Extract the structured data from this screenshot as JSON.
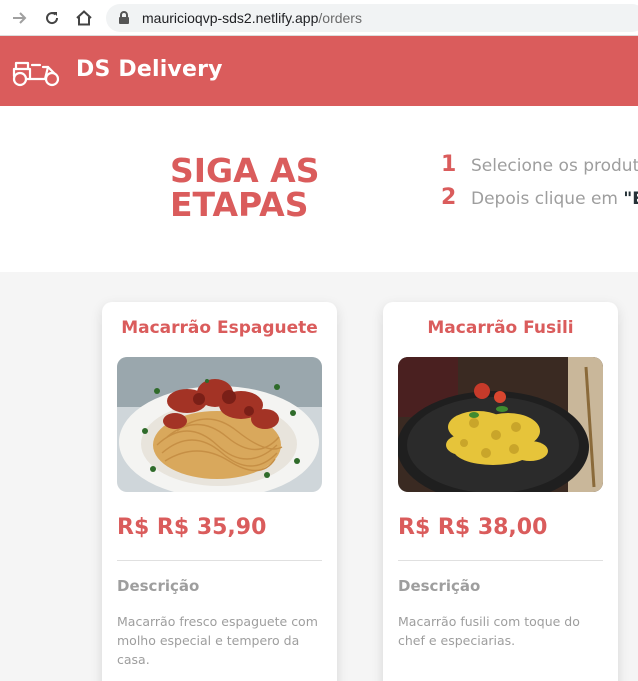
{
  "browser": {
    "url_host": "mauricioqvp-sds2.netlify.app",
    "url_path": "/orders"
  },
  "header": {
    "brand": "DS Delivery",
    "logo_icon": "scooter-icon"
  },
  "steps": {
    "title": "SIGA AS ETAPAS",
    "items": [
      {
        "number": "1",
        "text": "Selecione os produto",
        "strong": ""
      },
      {
        "number": "2",
        "text": "Depois clique em ",
        "strong": "\"EI"
      }
    ]
  },
  "products": [
    {
      "name": "Macarrão Espaguete",
      "price": "R$ R$ 35,90",
      "description_title": "Descrição",
      "description": "Macarrão fresco espaguete com molho especial e tempero da casa."
    },
    {
      "name": "Macarrão Fusili",
      "price": "R$ R$ 38,00",
      "description_title": "Descrição",
      "description": "Macarrão fusili com toque do chef e especiarias."
    }
  ],
  "colors": {
    "primary": "#da5c5c",
    "text_muted": "#9e9e9e",
    "background": "#f5f5f5"
  }
}
